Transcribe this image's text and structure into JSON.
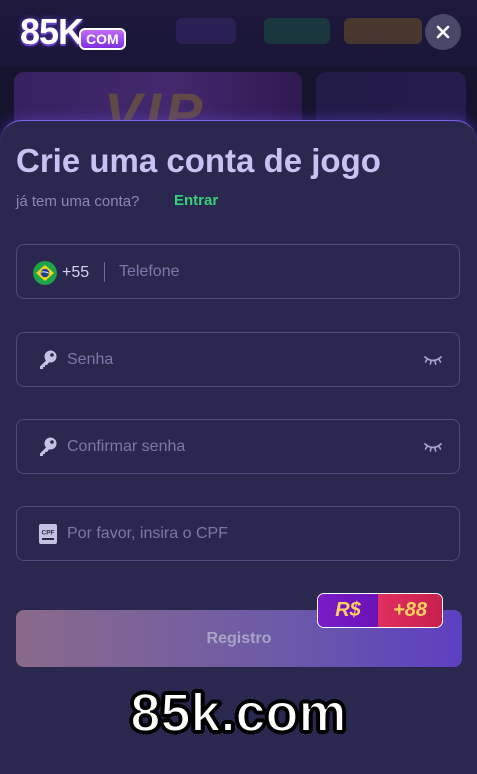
{
  "header": {
    "logo_main": "85K",
    "logo_suffix": "COM",
    "close_icon": "close-icon"
  },
  "background": {
    "banner_text": "VIP"
  },
  "form": {
    "title": "Crie uma conta de jogo",
    "have_account": "já tem uma conta?",
    "login_link": "Entrar",
    "phone": {
      "flag_icon": "brazil-flag-icon",
      "dial_code": "+55",
      "placeholder": "Telefone"
    },
    "password": {
      "icon": "key-icon",
      "placeholder": "Senha",
      "toggle_icon": "eye-closed-icon"
    },
    "confirm_password": {
      "icon": "key-icon",
      "placeholder": "Confirmar senha",
      "toggle_icon": "eye-closed-icon"
    },
    "cpf": {
      "icon": "id-card-icon",
      "icon_text": "CPF",
      "placeholder": "Por favor, insira o CPF"
    },
    "register_label": "Registro",
    "bonus": {
      "currency": "R$",
      "amount": "+88"
    }
  },
  "watermark": "85k.com",
  "colors": {
    "sheet_bg": "#2b2850",
    "title": "#c9c1f2",
    "link": "#33d17a",
    "accent_border": "#7c62e8"
  }
}
